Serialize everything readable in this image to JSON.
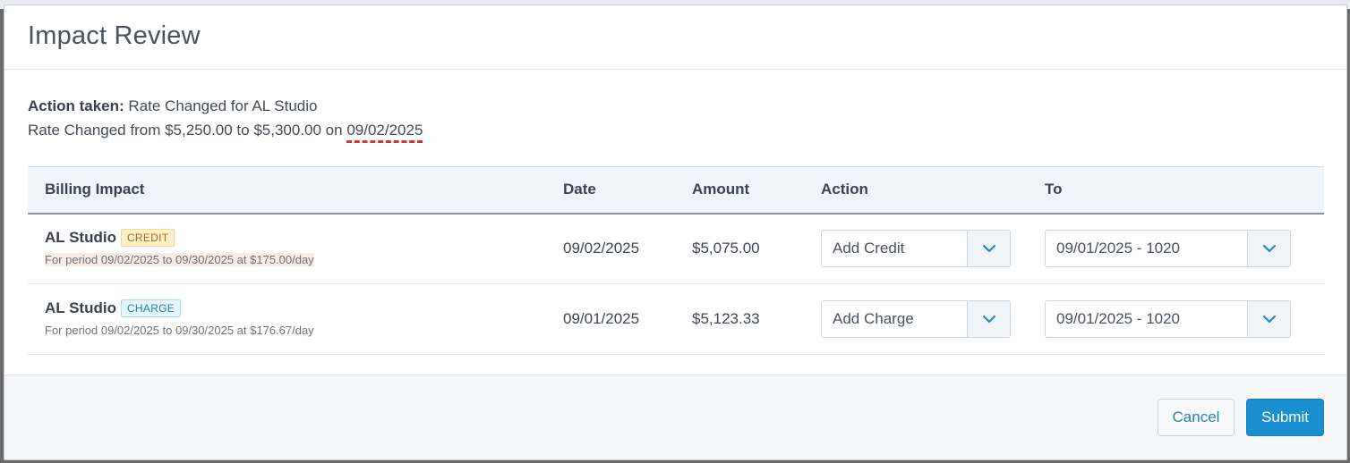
{
  "modal": {
    "title": "Impact Review"
  },
  "summary": {
    "action_label": "Action taken:",
    "action_value": " Rate Changed for AL Studio",
    "change_prefix": "Rate Changed from $5,250.00 to $5,300.00 on ",
    "change_date": "09/02/2025"
  },
  "table": {
    "headers": [
      "Billing Impact",
      "Date",
      "Amount",
      "Action",
      "To"
    ],
    "rows": [
      {
        "name": "AL Studio",
        "badge": "CREDIT",
        "period": "For period 09/02/2025 to 09/30/2025 at $175.00/day",
        "date": "09/02/2025",
        "amount": "$5,075.00",
        "action": "Add Credit",
        "to": "09/01/2025 - 1020"
      },
      {
        "name": "AL Studio",
        "badge": "CHARGE",
        "period": "For period 09/02/2025 to 09/30/2025 at $176.67/day",
        "date": "09/01/2025",
        "amount": "$5,123.33",
        "action": "Add Charge",
        "to": "09/01/2025 - 1020"
      }
    ]
  },
  "footer": {
    "cancel_label": "Cancel",
    "submit_label": "Submit"
  },
  "colors": {
    "accent": "#1a8fcf",
    "credit_badge": "#b3621b",
    "charge_badge": "#1f7fb5",
    "underline": "#d8322e"
  },
  "icons": {
    "select_toggle": "chevron-down-icon"
  }
}
